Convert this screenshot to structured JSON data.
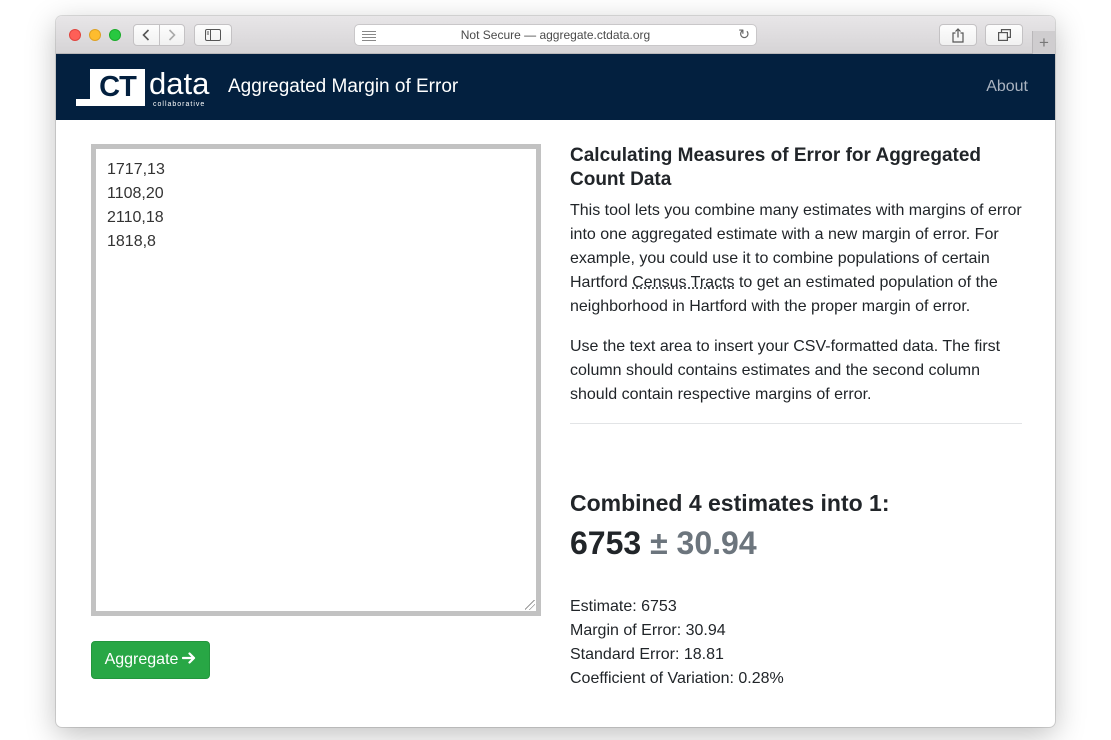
{
  "browser": {
    "url": "Not Secure — aggregate.ctdata.org",
    "reload_icon": "reload-icon",
    "back_icon": "chevron-left-icon",
    "forward_icon": "chevron-right-icon",
    "sidebar_icon": "sidebar-icon",
    "share_icon": "share-icon",
    "tabs_icon": "tabs-icon",
    "new_tab_label": "+"
  },
  "navbar": {
    "logo": {
      "ct": "CT",
      "data": "data",
      "sub": "collaborative"
    },
    "title": "Aggregated Margin of Error",
    "about": "About",
    "bg_color": "#03203f"
  },
  "input": {
    "value": "1717,13\n1108,20\n2110,18\n1818,8"
  },
  "aggregate_button": {
    "label": "Aggregate",
    "icon": "arrow-right-icon",
    "color": "#28a745"
  },
  "info": {
    "heading": "Calculating Measures of Error for Aggregated Count Data",
    "p1_before": "This tool lets you combine many estimates with margins of error into one aggregated estimate with a new margin of error. For example, you could use it to combine populations of certain Hartford ",
    "p1_link": "Census Tracts",
    "p1_after": " to get an estimated population of the neighborhood in Hartford with the proper margin of error.",
    "p2": "Use the text area to insert your CSV-formatted data. The first column should contains estimates and the second column should contain respective margins of error."
  },
  "result": {
    "combined_heading": "Combined 4 estimates into 1:",
    "estimate": "6753",
    "moe_display": "± 30.94",
    "stats": {
      "estimate": "Estimate: 6753",
      "margin_of_error": "Margin of Error: 30.94",
      "standard_error": "Standard Error: 18.81",
      "cv": "Coefficient of Variation: 0.28%"
    }
  }
}
